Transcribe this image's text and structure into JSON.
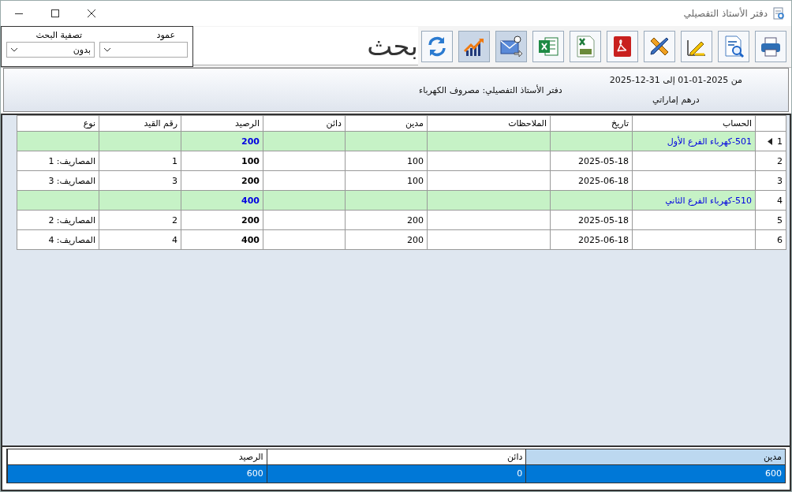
{
  "window": {
    "title": "دفتر الأستاذ التفصيلي"
  },
  "toolbar": {
    "buttons": [
      {
        "kind": "print",
        "highlighted": false
      },
      {
        "kind": "preview",
        "highlighted": false
      },
      {
        "kind": "edit-chart",
        "highlighted": false
      },
      {
        "kind": "design",
        "highlighted": false
      },
      {
        "kind": "pdf",
        "highlighted": false
      },
      {
        "kind": "csv",
        "highlighted": false
      },
      {
        "kind": "excel",
        "highlighted": false
      },
      {
        "kind": "email",
        "highlighted": true
      },
      {
        "kind": "chart",
        "highlighted": true
      },
      {
        "kind": "refresh",
        "highlighted": false
      }
    ]
  },
  "search": {
    "placeholder": "بحث"
  },
  "filters": [
    {
      "label": "عمود"
    },
    {
      "label": "تصفية البحث",
      "value": "بدون"
    }
  ],
  "report_header": {
    "period": "من 2025-01-01 إلى 31-12-2025",
    "title": "دفتر الأستاذ التفصيلي: مصروف الكهرباء",
    "currency": "درهم إماراتي"
  },
  "table": {
    "columns": [
      "الحساب",
      "تاريخ",
      "الملاحظات",
      "مدين",
      "دائن",
      "الرصيد",
      "رقم القيد",
      "نوع"
    ],
    "rows": [
      {
        "number": "1",
        "kind": "group",
        "current": true,
        "account": "501-كهرباء الفرع الأول",
        "balance": "200"
      },
      {
        "number": "2",
        "kind": "entry",
        "current": false,
        "date": "2025-05-18",
        "debit": "100",
        "balance": "100",
        "entry_no": "1",
        "type": "المصاريف: 1"
      },
      {
        "number": "3",
        "kind": "entry",
        "current": false,
        "date": "2025-06-18",
        "debit": "100",
        "balance": "200",
        "entry_no": "3",
        "type": "المصاريف: 3"
      },
      {
        "number": "4",
        "kind": "group",
        "current": false,
        "account": "510-كهرباء الفرع الثاني",
        "balance": "400"
      },
      {
        "number": "5",
        "kind": "entry",
        "current": false,
        "date": "2025-05-18",
        "debit": "200",
        "balance": "200",
        "entry_no": "2",
        "type": "المصاريف: 2"
      },
      {
        "number": "6",
        "kind": "entry",
        "current": false,
        "date": "2025-06-18",
        "debit": "200",
        "balance": "400",
        "entry_no": "4",
        "type": "المصاريف: 4"
      }
    ]
  },
  "totals": {
    "row_selected": true,
    "columns": [
      {
        "label": "مدين",
        "selected": true,
        "value": "600"
      },
      {
        "label": "دائن",
        "selected": false,
        "value": "0"
      },
      {
        "label": "الرصيد",
        "selected": false,
        "value": "600"
      }
    ]
  }
}
